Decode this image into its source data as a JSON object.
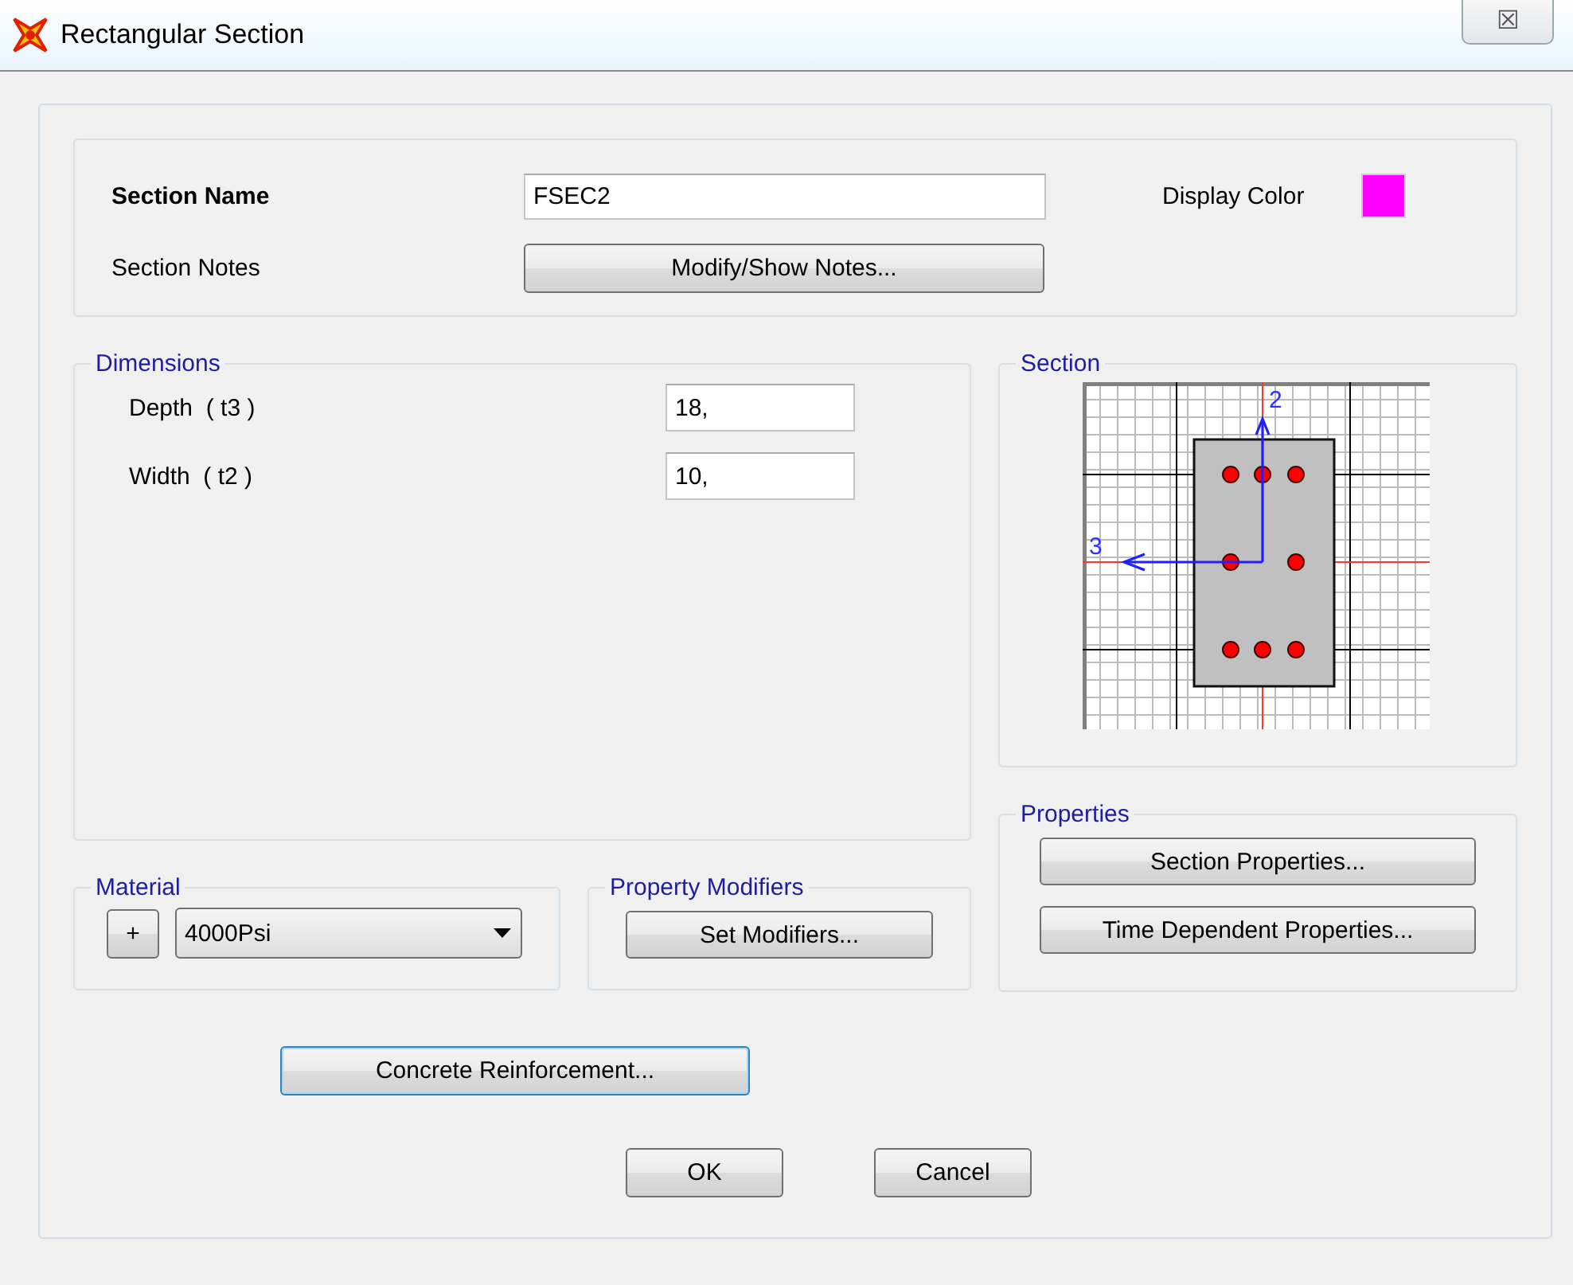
{
  "window": {
    "title": "Rectangular Section",
    "close": "☒"
  },
  "section_name": {
    "label": "Section Name",
    "value": "FSEC2"
  },
  "display_color": {
    "label": "Display Color",
    "color": "#ff00ff"
  },
  "section_notes": {
    "label": "Section Notes",
    "button": "Modify/Show Notes..."
  },
  "dimensions": {
    "title": "Dimensions",
    "fields": [
      {
        "label": "Depth  ( t3 )",
        "value": "18,"
      },
      {
        "label": "Width  ( t2 )",
        "value": "10,"
      }
    ]
  },
  "section_preview": {
    "title": "Section",
    "axis_labels": [
      "2",
      "3"
    ]
  },
  "material": {
    "title": "Material",
    "add_button": "+",
    "value": "4000Psi"
  },
  "property_modifiers": {
    "title": "Property Modifiers",
    "button": "Set Modifiers..."
  },
  "properties": {
    "title": "Properties",
    "buttons": [
      "Section Properties...",
      "Time Dependent Properties..."
    ]
  },
  "concrete_reinforcement_button": "Concrete Reinforcement...",
  "buttons": [
    "OK",
    "Cancel"
  ]
}
